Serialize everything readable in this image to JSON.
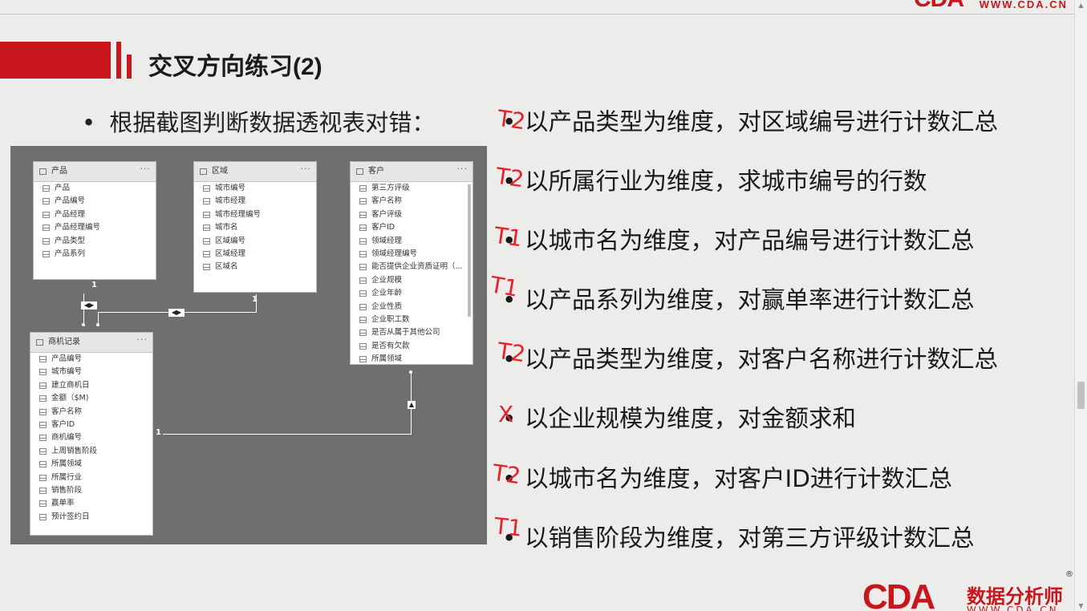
{
  "header": {
    "logo_top_text": "CDA",
    "logo_top_url": "WWW.CDA.CN",
    "title": "交叉方向练习(2)"
  },
  "intro": {
    "bullet": "•",
    "text": "根据截图判断数据透视表对错："
  },
  "diagram": {
    "tables": {
      "product": {
        "name": "产品",
        "fields": [
          "产品",
          "产品编号",
          "产品经理",
          "产品经理编号",
          "产品类型",
          "产品系列"
        ]
      },
      "region": {
        "name": "区域",
        "fields": [
          "城市编号",
          "城市经理",
          "城市经理编号",
          "城市名",
          "区域编号",
          "区域经理",
          "区域名"
        ]
      },
      "customer": {
        "name": "客户",
        "fields": [
          "第三方评级",
          "客户名称",
          "客户评级",
          "客户ID",
          "领域经理",
          "领域经理编号",
          "能否提供企业资质证明（...",
          "企业规模",
          "企业年龄",
          "企业性质",
          "企业职工数",
          "是否从属于其他公司",
          "是否有欠款",
          "所属领域"
        ]
      },
      "opportunity": {
        "name": "商机记录",
        "fields": [
          "产品编号",
          "城市编号",
          "建立商机日",
          "金额（$M)",
          "客户名称",
          "客户ID",
          "商机编号",
          "上周销售阶段",
          "所属领域",
          "所属行业",
          "销售阶段",
          "赢单率",
          "预计签约日"
        ]
      }
    },
    "more_icon": "···",
    "cardinality_one": "1",
    "arrow_both": "◀▶",
    "arrow_up": "▲"
  },
  "statements": [
    {
      "text": "以产品类型为维度，对区域编号进行计数汇总",
      "mark": "T2"
    },
    {
      "text": "以所属行业为维度，求城市编号的行数",
      "mark": "T2"
    },
    {
      "text": "以城市名为维度，对产品编号进行计数汇总",
      "mark": "T1"
    },
    {
      "text": "以产品系列为维度，对赢单率进行计数汇总",
      "mark": "T1"
    },
    {
      "text": "以产品类型为维度，对客户名称进行计数汇总",
      "mark": "T2"
    },
    {
      "text": "以企业规模为维度，对金额求和",
      "mark": "X"
    },
    {
      "text": "以城市名为维度，对客户ID进行计数汇总",
      "mark": "T2"
    },
    {
      "text": "以销售阶段为维度，对第三方评级计数汇总",
      "mark": "T1"
    }
  ],
  "bullet": "•",
  "footer": {
    "logo_text": "CDA",
    "logo_cn": "数据分析师",
    "logo_url": "WWW.CDA.CN",
    "registered": "®"
  },
  "colors": {
    "brand_red": "#c8171c",
    "annotation_red": "#e8202a",
    "diagram_bg": "#6f6f6f"
  }
}
